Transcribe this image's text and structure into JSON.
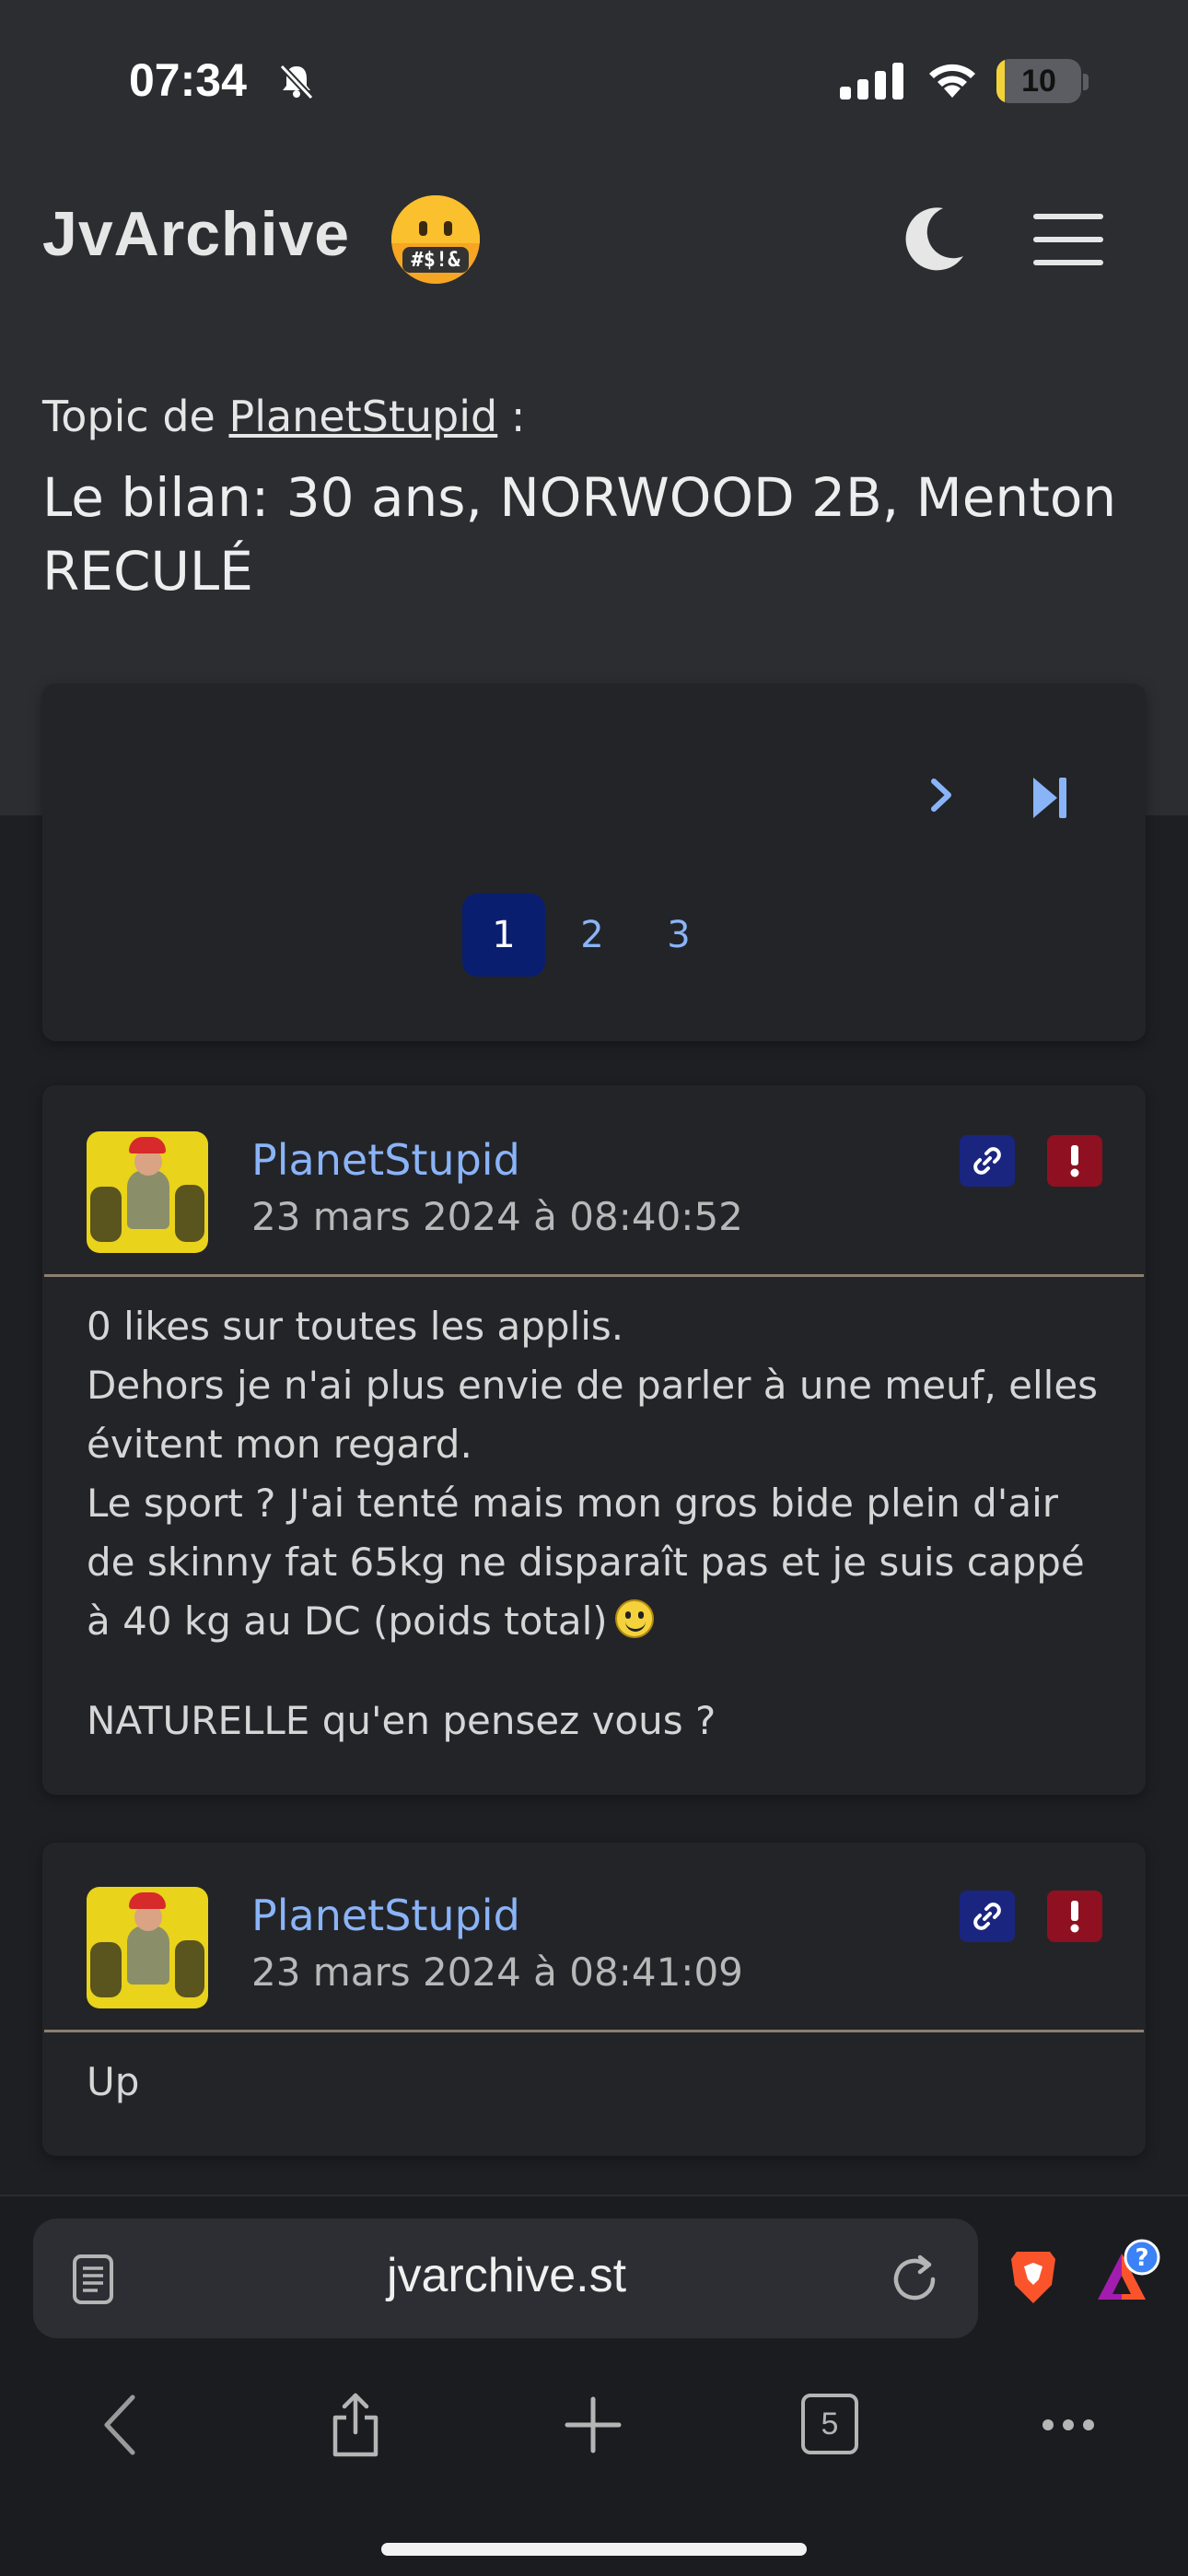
{
  "status_bar": {
    "time": "07:34",
    "battery_level": "10",
    "battery_fraction": 0.1
  },
  "app": {
    "brand": "JvArchive",
    "brand_emoji_text": "#$!&"
  },
  "topic": {
    "by_prefix": "Topic de ",
    "author": "PlanetStupid",
    "by_suffix": " :",
    "title": "Le bilan: 30 ans, NORWOOD 2B, Menton RECULÉ"
  },
  "pagination": {
    "pages": [
      "1",
      "2",
      "3"
    ],
    "current": "1"
  },
  "posts": [
    {
      "author": "PlanetStupid",
      "date": "23 mars 2024 à 08:40:52",
      "lines": [
        "0 likes sur toutes les applis.",
        "Dehors je n'ai plus envie de parler à une meuf, elles évitent mon regard.",
        "Le sport ? J'ai tenté mais mon gros bide plein d'air de skinny fat 65kg ne disparaît pas et je suis cappé à 40 kg au DC (poids total)",
        "NATURELLE qu'en pensez vous ?"
      ]
    },
    {
      "author": "PlanetStupid",
      "date": "23 mars 2024 à 08:41:09",
      "lines": [
        "Up"
      ]
    }
  ],
  "browser": {
    "url": "jvarchive.st",
    "tabs_count": "5",
    "rewards_badge": "?"
  },
  "colors": {
    "accent_link": "#8ab4f8",
    "active_page": "#0a1e70",
    "link_button": "#1a2580",
    "report_button": "#8f1020"
  }
}
